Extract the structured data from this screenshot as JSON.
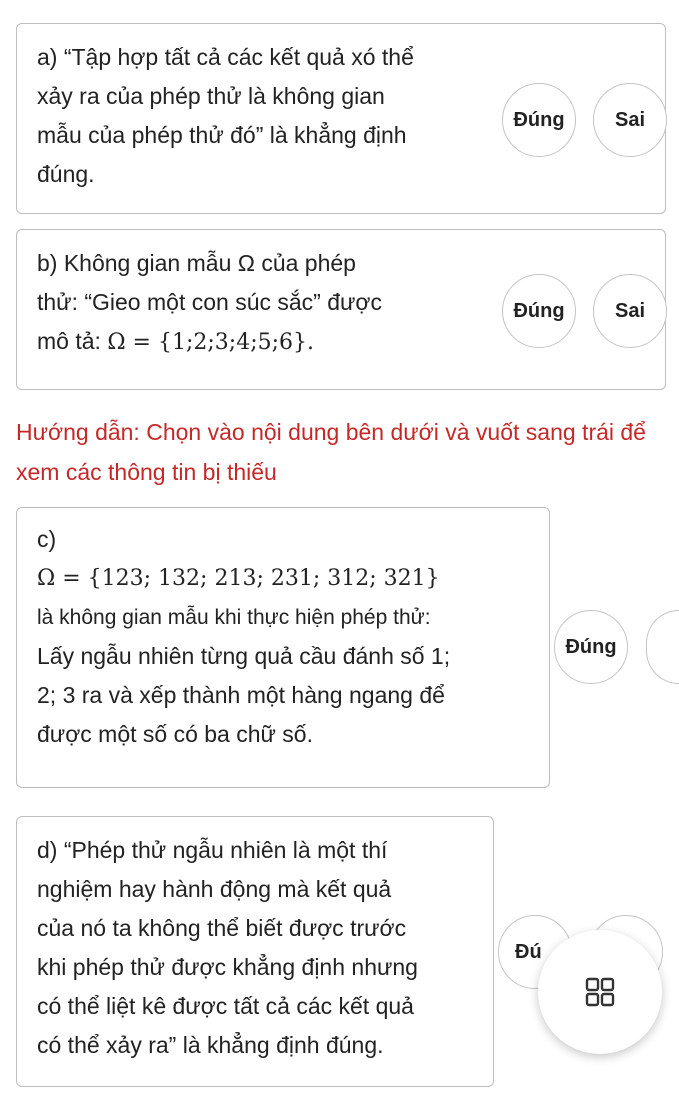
{
  "cards": {
    "a": {
      "lines": [
        "a) “Tập hợp tất cả các kết quả xó thể",
        "xảy ra của phép thử là không gian",
        "mẫu của phép thử đó” là khẳng định",
        "đúng."
      ],
      "true_label": "Đúng",
      "false_label": "Sai"
    },
    "b": {
      "line1": "b) Không gian mẫu Ω của phép",
      "line2": "thử: “Gieo một con súc sắc” được",
      "line3_prefix": "mô tả: ",
      "math": "Ω = {1;2;3;4;5;6}.",
      "true_label": "Đúng",
      "false_label": "Sai"
    },
    "c": {
      "line1": "c)",
      "math": "Ω = {123; 132; 213; 231; 312; 321}",
      "lines": [
        "là không gian mẫu khi thực hiện phép thử:",
        "Lấy ngẫu nhiên từng quả cầu đánh số 1;",
        "2; 3 ra và xếp thành một hàng ngang để",
        "được một số có ba chữ số."
      ],
      "true_label": "Đúng"
    },
    "d": {
      "lines": [
        "d) “Phép thử ngẫu nhiên là một thí",
        "nghiệm hay hành động mà kết quả",
        "của nó ta không thể biết được trước",
        "khi phép thử được khẳng định nhưng",
        "có thể liệt kê được tất cả các kết quả",
        "có thể xảy ra” là khẳng định đúng."
      ],
      "true_label": "Đú"
    }
  },
  "guide_text": "Hướng dẫn: Chọn vào nội dung bên dưới và vuốt sang trái để xem các thông tin bị thiếu",
  "fab": {
    "icon": "grid-icon"
  },
  "colors": {
    "guide": "#c62828",
    "border": "#bdbdbd",
    "text": "#222222"
  }
}
